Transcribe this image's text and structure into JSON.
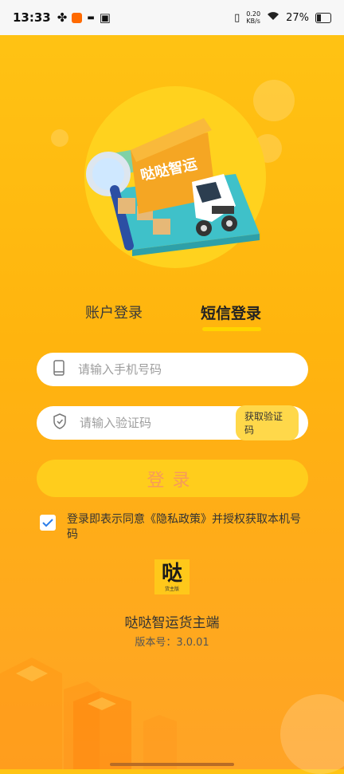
{
  "status_bar": {
    "time": "13:33",
    "net_speed_value": "0.20",
    "net_speed_unit": "KB/s",
    "battery": "27%"
  },
  "hero": {
    "truck_text": "哒哒智运"
  },
  "tabs": {
    "account_login": "账户登录",
    "sms_login": "短信登录"
  },
  "phone_field": {
    "placeholder": "请输入手机号码",
    "value": ""
  },
  "code_field": {
    "placeholder": "请输入验证码",
    "value": "",
    "get_code_label": "获取验证码"
  },
  "login_button": {
    "label": "登录"
  },
  "agreement": {
    "checked": true,
    "text_before": "登录即表示同意",
    "policy_link": "《隐私政策》",
    "text_after": "并授权获取本机号码"
  },
  "app": {
    "logo_text": "哒",
    "logo_subtext": "货主版",
    "name": "哒哒智运货主端",
    "version_label": "版本号：",
    "version": "3.0.01"
  },
  "colors": {
    "accent": "#ffd400",
    "background_top": "#ffc414",
    "background_bottom": "#ffa326",
    "login_text": "#f79b5a"
  }
}
